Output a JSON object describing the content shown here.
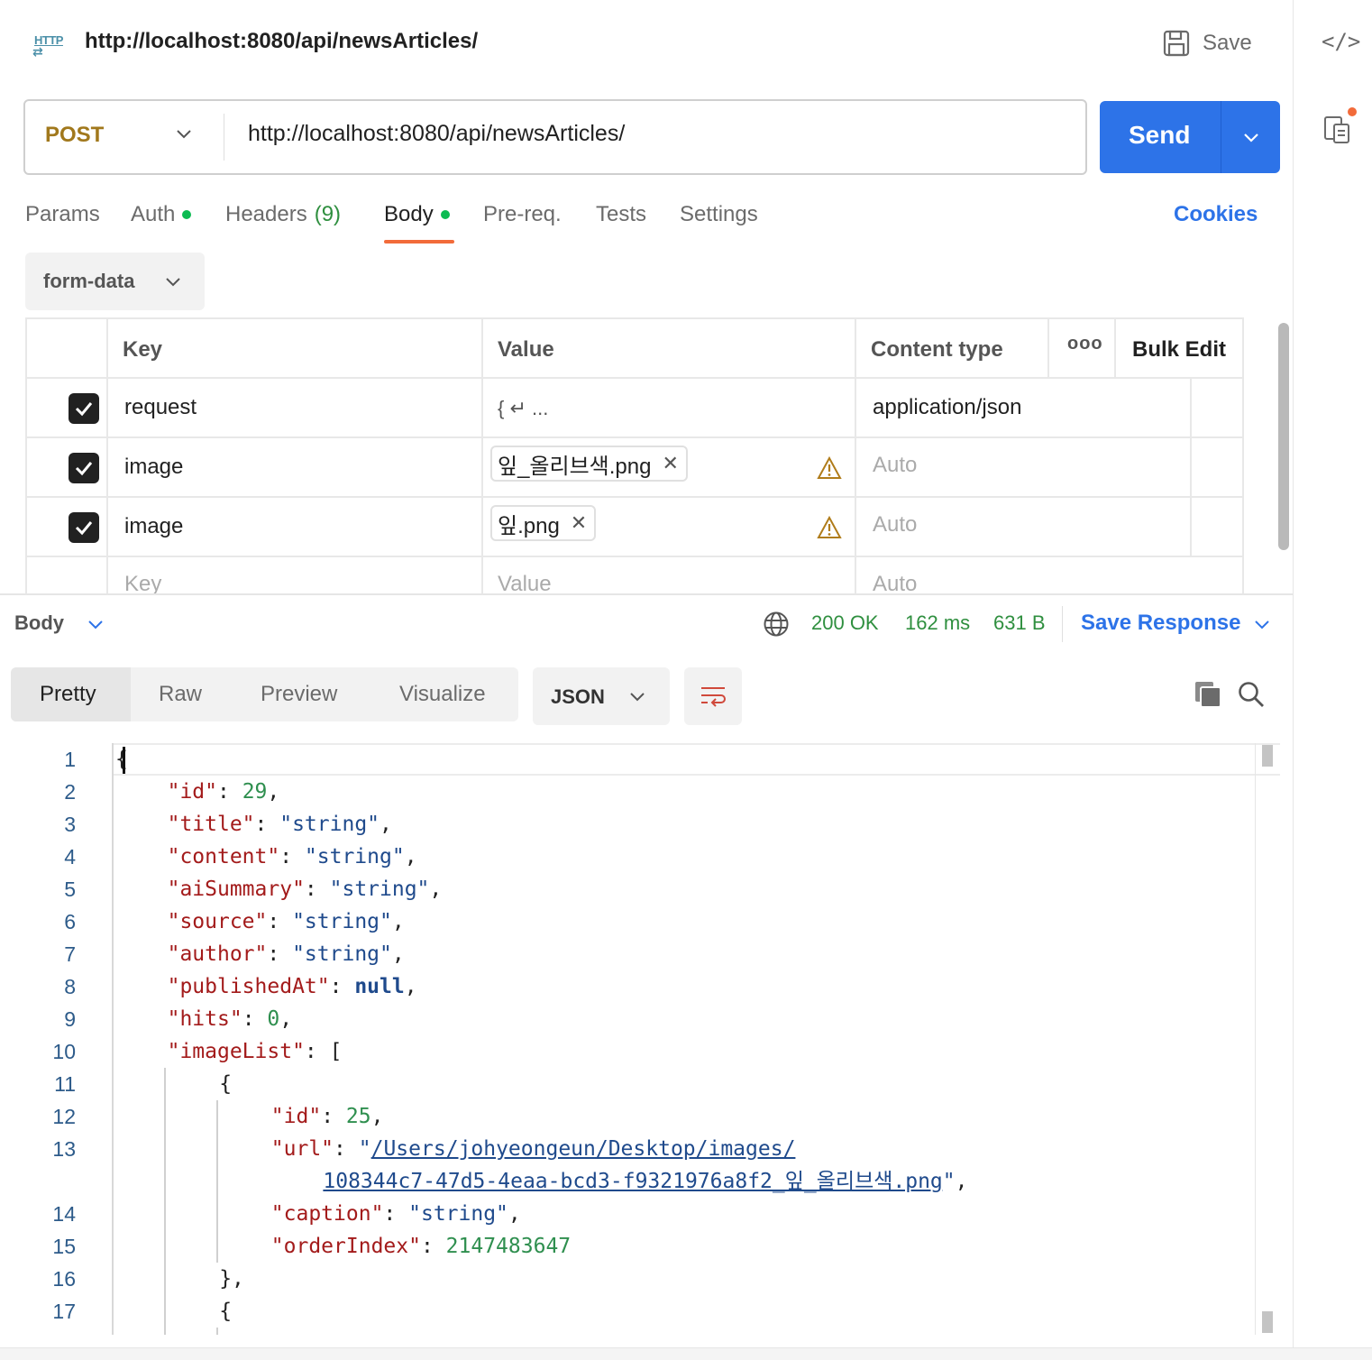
{
  "header": {
    "protocol_icon_label": "HTTP",
    "title": "http://localhost:8080/api/newsArticles/",
    "save_label": "Save"
  },
  "request": {
    "method": "POST",
    "url": "http://localhost:8080/api/newsArticles/",
    "send_label": "Send"
  },
  "tabs": [
    {
      "label": "Params"
    },
    {
      "label": "Auth"
    },
    {
      "label": "Headers",
      "count": "(9)"
    },
    {
      "label": "Body"
    },
    {
      "label": "Pre-req."
    },
    {
      "label": "Tests"
    },
    {
      "label": "Settings"
    }
  ],
  "cookies_label": "Cookies",
  "body_mode": "form-data",
  "form_table": {
    "headers": {
      "key": "Key",
      "value": "Value",
      "content_type": "Content type",
      "more": "ooo",
      "bulk_edit": "Bulk Edit"
    },
    "rows": [
      {
        "key": "request",
        "value": "{ ↵ ...",
        "content_type": "application/json"
      },
      {
        "key": "image",
        "value": "잎_올리브색.png",
        "content_type": "Auto"
      },
      {
        "key": "image",
        "value": "잎.png",
        "content_type": "Auto"
      }
    ],
    "placeholder": {
      "key": "Key",
      "value": "Value",
      "content_type": "Auto"
    }
  },
  "response": {
    "section_label": "Body",
    "status": "200 OK",
    "time": "162 ms",
    "size": "631 B",
    "save_response_label": "Save Response",
    "view_tabs": [
      "Pretty",
      "Raw",
      "Preview",
      "Visualize"
    ],
    "format": "JSON",
    "line_numbers": [
      "1",
      "2",
      "3",
      "4",
      "5",
      "6",
      "7",
      "8",
      "9",
      "10",
      "11",
      "12",
      "13",
      "14",
      "15",
      "16",
      "17"
    ]
  },
  "colors": {
    "accent": "#2d73e8",
    "method": "#a1781c",
    "status_ok": "#2f8f3f",
    "active_tab_underline": "#f26b3a",
    "indicator_dot": "#0cbb52"
  },
  "icons": [
    "http-icon",
    "floppy-save-icon",
    "code-icon",
    "document-icon",
    "chevron-down-icon",
    "check-icon",
    "close-icon",
    "warning-icon",
    "globe-icon",
    "wrap-lines-icon",
    "copy-icon",
    "search-icon"
  ]
}
